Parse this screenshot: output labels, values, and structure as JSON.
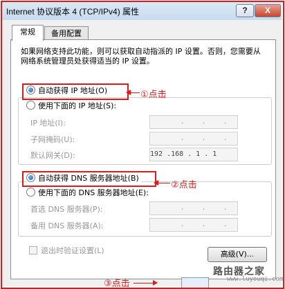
{
  "window": {
    "title": "Internet 协议版本 4 (TCP/IPv4) 属性",
    "help_button": "?",
    "close_button": "X"
  },
  "tabs": [
    {
      "label": "常规",
      "active": true
    },
    {
      "label": "备用配置",
      "active": false
    }
  ],
  "description": "如果网络支持此功能，则可以获取自动指派的 IP 设置。否则，您需要从网络系统管理员处获得适当的 IP 设置。",
  "ip_section": {
    "auto_option": {
      "label": "自动获得 IP 地址(O)",
      "selected": true
    },
    "manual_option": {
      "label": "使用下面的 IP 地址(S):",
      "selected": false
    },
    "fields": [
      {
        "label": "IP 地址(I):",
        "value": ". . ."
      },
      {
        "label": "子网掩码(U):",
        "value": ". . ."
      },
      {
        "label": "默认网关(D):",
        "value": "192 .168 . 1 . 1"
      }
    ]
  },
  "dns_section": {
    "auto_option": {
      "label": "自动获得 DNS 服务器地址(B)",
      "selected": true
    },
    "manual_option": {
      "label": "使用下面的 DNS 服务器地址(E):",
      "selected": false
    },
    "fields": [
      {
        "label": "首选 DNS 服务器(P):",
        "value": ". . ."
      },
      {
        "label": "备用 DNS 服务器(A):",
        "value": ". . ."
      }
    ]
  },
  "validate_checkbox": {
    "label": "退出时验证设置(L)",
    "checked": false
  },
  "advanced_button": "高级(V)...",
  "annotations": {
    "step1": "①点击",
    "step2": "②点击",
    "step3": "③点击"
  },
  "watermark": {
    "text": "路由器之家",
    "url": "www.luyouqi.com"
  },
  "colors": {
    "annotation_red": "#e01818",
    "radio_selected": "#1f5fb0"
  }
}
